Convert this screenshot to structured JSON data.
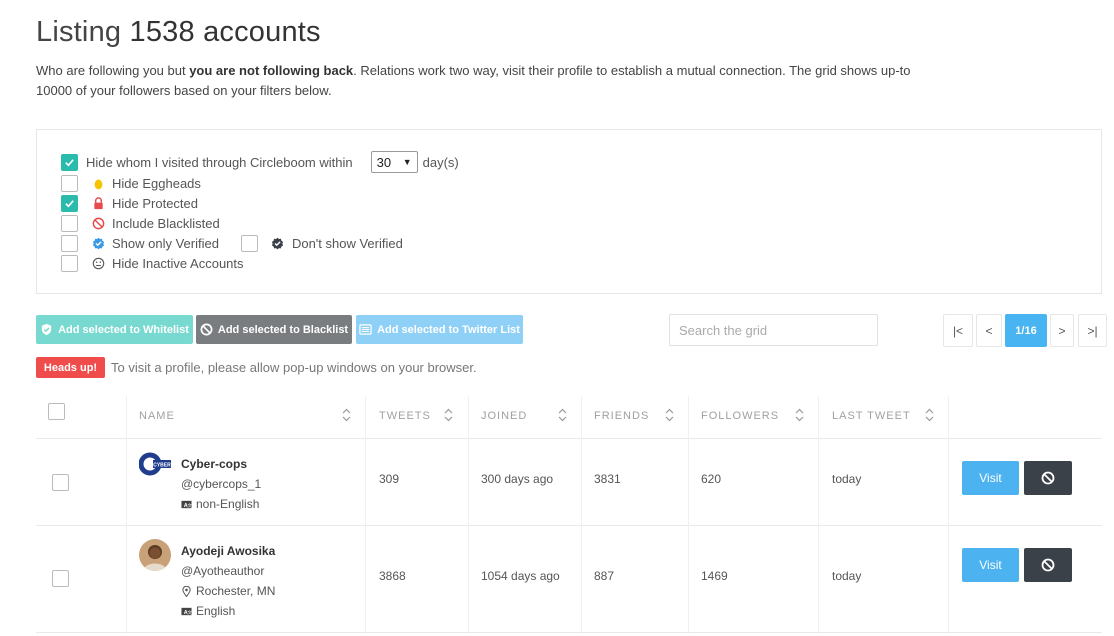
{
  "header": {
    "title_prefix": "Listing",
    "title_count": "1538 accounts",
    "subtitle_pre": "Who are following you but ",
    "subtitle_bold": "you are not following back",
    "subtitle_post": ". Relations work two way, visit their profile to establish a mutual connection. The grid shows up-to 10000 of your followers based on your filters below."
  },
  "filters": {
    "hide_visited": {
      "label": "Hide whom I visited through Circleboom within",
      "checked": true,
      "days_value": "30",
      "days_unit": "day(s)"
    },
    "hide_eggheads": {
      "label": "Hide Eggheads",
      "checked": false
    },
    "hide_protected": {
      "label": "Hide Protected",
      "checked": true
    },
    "include_blacklisted": {
      "label": "Include Blacklisted",
      "checked": false
    },
    "show_only_verified": {
      "label": "Show only Verified",
      "checked": false
    },
    "dont_show_verified": {
      "label": "Don't show Verified",
      "checked": false
    },
    "hide_inactive": {
      "label": "Hide Inactive Accounts",
      "checked": false
    }
  },
  "actions": {
    "whitelist_label": "Add selected to Whitelist",
    "blacklist_label": "Add selected to Blacklist",
    "twitter_list_label": "Add selected to Twitter List"
  },
  "search": {
    "placeholder": "Search the grid"
  },
  "pagination": {
    "first": "|<",
    "prev": "<",
    "current": "1/16",
    "next": ">",
    "last": ">|"
  },
  "notice": {
    "badge": "Heads up!",
    "text": "To visit a profile, please allow pop-up windows on your browser."
  },
  "table": {
    "columns": [
      "NAME",
      "TWEETS",
      "JOINED",
      "FRIENDS",
      "FOLLOWERS",
      "LAST TWEET"
    ],
    "rows": [
      {
        "name": "Cyber-cops",
        "handle": "@cybercops_1",
        "location": "",
        "language": "non-English",
        "tweets": "309",
        "joined": "300 days ago",
        "friends": "3831",
        "followers": "620",
        "last_tweet": "today",
        "visit_label": "Visit"
      },
      {
        "name": "Ayodeji Awosika",
        "handle": "@Ayotheauthor",
        "location": "Rochester, MN",
        "language": "English",
        "tweets": "3868",
        "joined": "1054 days ago",
        "friends": "887",
        "followers": "1469",
        "last_tweet": "today",
        "visit_label": "Visit"
      }
    ]
  },
  "colors": {
    "teal": "#2bbbad",
    "whitelist_btn": "#77d9cf",
    "blacklist_btn": "#7a7d80",
    "twitter_btn": "#8fd0f7",
    "pager_active": "#49b4f2",
    "badge_red": "#f14c4c",
    "visit_btn": "#4cb3f0",
    "block_btn": "#3a4149"
  },
  "icons": {
    "egghead": "egg-icon",
    "protected": "lock-icon",
    "blacklisted": "ban-icon",
    "verified": "verified-badge-icon",
    "not_verified": "verified-dark-icon",
    "inactive": "neutral-face-icon",
    "location": "map-pin-icon",
    "language": "language-icon"
  }
}
